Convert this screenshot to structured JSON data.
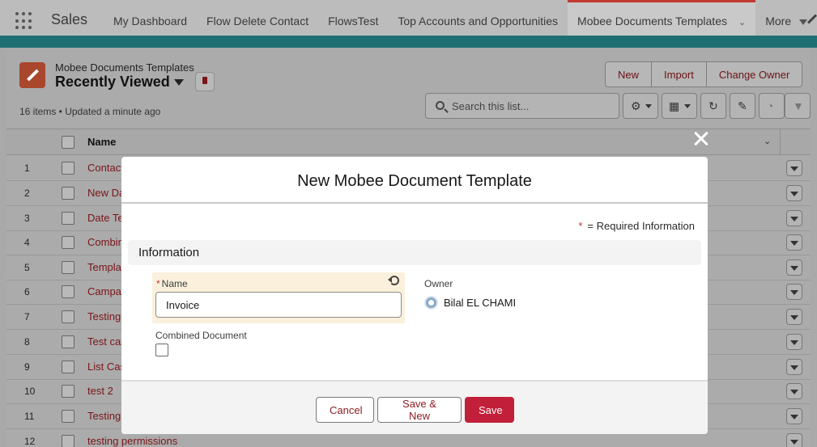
{
  "nav": {
    "app_name": "Sales",
    "items": [
      {
        "label": "My Dashboard"
      },
      {
        "label": "Flow Delete Contact"
      },
      {
        "label": "FlowsTest"
      },
      {
        "label": "Top Accounts and Opportunities"
      },
      {
        "label": "Mobee Documents Templates",
        "active": true
      }
    ],
    "more_label": "More"
  },
  "list_header": {
    "object_label": "Mobee Documents Templates",
    "view_name": "Recently Viewed",
    "meta": "16 items • Updated a minute ago",
    "buttons": {
      "new": "New",
      "import": "Import",
      "change_owner": "Change Owner"
    },
    "search_placeholder": "Search this list..."
  },
  "table": {
    "column_name": "Name",
    "rows": [
      {
        "num": "1",
        "name": "Contact"
      },
      {
        "num": "2",
        "name": "New Da"
      },
      {
        "num": "3",
        "name": "Date Te"
      },
      {
        "num": "4",
        "name": "Combin"
      },
      {
        "num": "5",
        "name": "Templa"
      },
      {
        "num": "6",
        "name": "Campai"
      },
      {
        "num": "7",
        "name": "Testing"
      },
      {
        "num": "8",
        "name": "Test cas"
      },
      {
        "num": "9",
        "name": "List Cas"
      },
      {
        "num": "10",
        "name": "test 2"
      },
      {
        "num": "11",
        "name": "Testing"
      },
      {
        "num": "12",
        "name": "testing permissions"
      }
    ]
  },
  "modal": {
    "title": "New Mobee Document Template",
    "required_star": "*",
    "required_text": "= Required Information",
    "section_title": "Information",
    "name_field": {
      "star": "*",
      "label": "Name",
      "value": "Invoice"
    },
    "owner": {
      "label": "Owner",
      "name": "Bilal EL CHAMI"
    },
    "combined": {
      "label": "Combined Document",
      "checked": false
    },
    "buttons": {
      "cancel": "Cancel",
      "save_new": "Save & New",
      "save": "Save"
    }
  },
  "colors": {
    "brand": "#c21f3a",
    "link": "#7a1518",
    "accent": "#1d6f72",
    "required": "#c23934"
  }
}
